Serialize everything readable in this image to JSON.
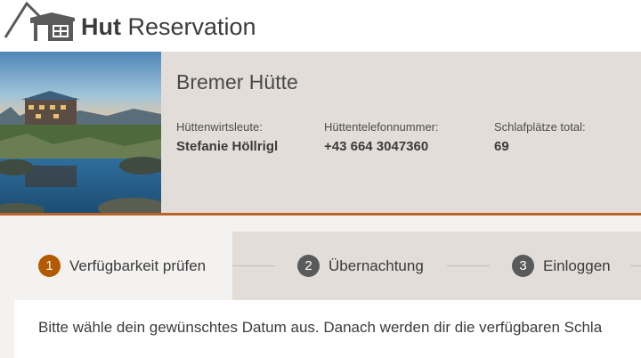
{
  "header": {
    "logo_bold": "Hut",
    "logo_rest": " Reservation"
  },
  "hut": {
    "name": "Bremer Hütte",
    "photo_icon": "mountain-hut-lake-photo",
    "info": [
      {
        "label": "Hüttenwirtsleute:",
        "value": "Stefanie Höllrigl"
      },
      {
        "label": "Hüttentelefonnummer:",
        "value": "+43 664 3047360"
      },
      {
        "label": "Schlafplätze total:",
        "value": "69"
      }
    ]
  },
  "steps": [
    {
      "number": "1",
      "label": "Verfügbarkeit prüfen",
      "active": true
    },
    {
      "number": "2",
      "label": "Übernachtung",
      "active": false
    },
    {
      "number": "3",
      "label": "Einloggen",
      "active": false
    }
  ],
  "content": {
    "instruction": "Bitte wähle dein gewünschtes Datum aus. Danach werden dir die verfügbaren Schla"
  },
  "colors": {
    "accent": "#b35a00",
    "panel_bg": "#e2ddd8",
    "divider": "#b8642a"
  }
}
